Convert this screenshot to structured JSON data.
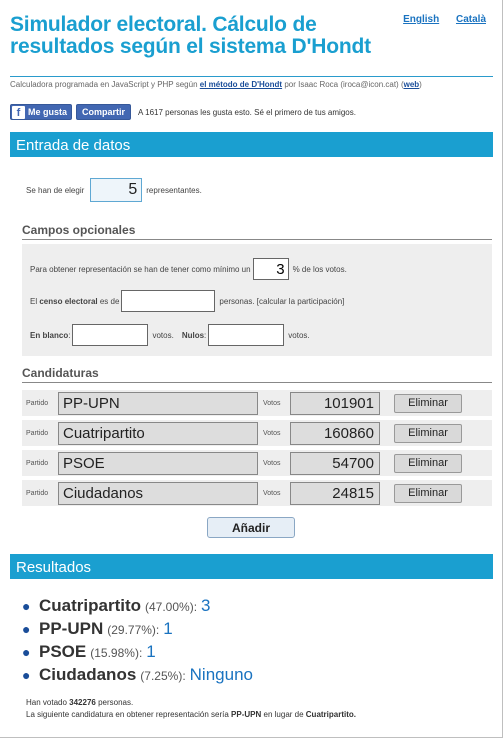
{
  "header": {
    "title": "Simulador electoral. Cálculo de resultados según el sistema D'Hondt",
    "lang_english": "English",
    "lang_catala": "Català",
    "byline_pre": "Calculadora programada en JavaScript y PHP según",
    "byline_link": "el método de D'Hondt",
    "byline_mid": "por Isaac Roca (iroca@icon.cat) (",
    "byline_web": "web",
    "byline_post": ")"
  },
  "social": {
    "like_label": "Me gusta",
    "share_label": "Compartir",
    "like_text": "A 1617 personas les gusta esto. Sé el primero de tus amigos."
  },
  "input_section": {
    "title": "Entrada de datos",
    "seats_pre": "Se han de elegir",
    "seats_value": "5",
    "seats_post": "representantes."
  },
  "optional": {
    "title": "Campos opcionales",
    "threshold_pre": "Para obtener representación se han de tener como mínimo un",
    "threshold_value": "3",
    "threshold_post": "% de los votos.",
    "census_pre": "El",
    "census_bold": "censo electoral",
    "census_mid": "es de",
    "census_value": "",
    "census_post": "personas. [calcular la participación]",
    "blank_label": "En blanco",
    "blank_value": "",
    "votes_word": "votos.",
    "null_label": "Nulos",
    "null_value": ""
  },
  "candidates": {
    "title": "Candidaturas",
    "party_label": "Partido",
    "votes_label": "Votos",
    "delete_label": "Eliminar",
    "add_label": "Añadir",
    "rows": [
      {
        "party": "PP-UPN",
        "votes": "101901"
      },
      {
        "party": "Cuatripartito",
        "votes": "160860"
      },
      {
        "party": "PSOE",
        "votes": "54700"
      },
      {
        "party": "Ciudadanos",
        "votes": "24815"
      }
    ]
  },
  "results": {
    "title": "Resultados",
    "items": [
      {
        "name": "Cuatripartito",
        "pct": "(47.00%):",
        "seats": "3"
      },
      {
        "name": "PP-UPN",
        "pct": "(29.77%):",
        "seats": "1"
      },
      {
        "name": "PSOE",
        "pct": "(15.98%):",
        "seats": "1"
      },
      {
        "name": "Ciudadanos",
        "pct": "(7.25%):",
        "seats": "Ninguno"
      }
    ],
    "voted_pre": "Han votado",
    "voted_value": "342276",
    "voted_post": "personas.",
    "next_pre": "La siguiente candidatura en obtener representación sería",
    "next_party": "PP-UPN",
    "next_mid": "en lugar de",
    "next_replaced": "Cuatripartito."
  },
  "colors": {
    "accent": "#1a9fd0",
    "link": "#1a73c0",
    "facebook": "#4267b2"
  }
}
